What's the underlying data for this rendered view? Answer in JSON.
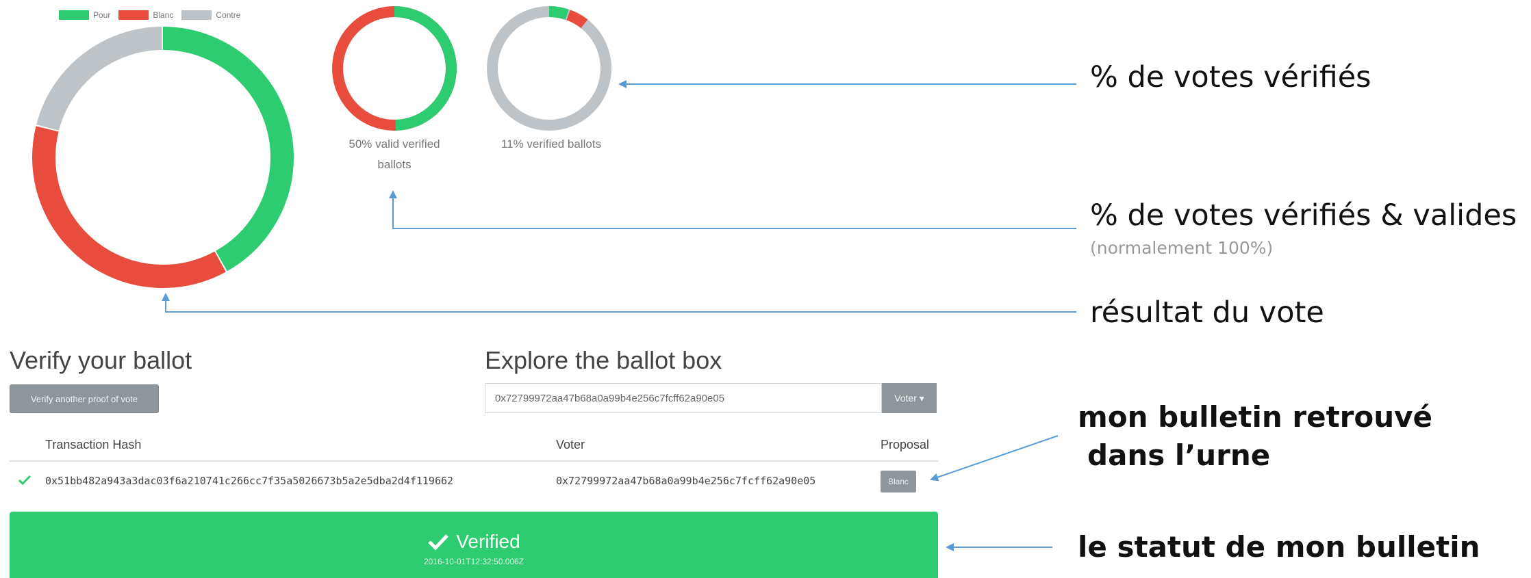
{
  "legend": [
    {
      "label": "Pour",
      "color": "#2ecc71"
    },
    {
      "label": "Blanc",
      "color": "#e74c3c"
    },
    {
      "label": "Contre",
      "color": "#bdc3c7"
    }
  ],
  "charts": {
    "result": {
      "pour": 0.42,
      "blanc": 0.37,
      "contre": 0.21
    },
    "valid": {
      "valid_fraction": 0.5,
      "caption": "50% valid verified ballots"
    },
    "verified": {
      "verified_fraction": 0.11,
      "caption": "11% verified ballots"
    }
  },
  "annotations": {
    "verified_pct": "% de votes vérifiés",
    "verified_valid_pct": "% de votes vérifiés & valides",
    "verified_valid_note": "(normalement 100%)",
    "vote_result": "résultat du vote",
    "ballot_found_line1": "mon bulletin retrouvé",
    "ballot_found_line2": "dans l’urne",
    "ballot_status": "le statut de mon bulletin"
  },
  "verify": {
    "title": "Verify your ballot",
    "button": "Verify another proof of vote"
  },
  "explore": {
    "title": "Explore the ballot box",
    "search_value": "0x72799972aa47b68a0a99b4e256c7fcff62a90e05",
    "dropdown_label": "Voter ▾"
  },
  "table": {
    "headers": {
      "hash": "Transaction Hash",
      "voter": "Voter",
      "proposal": "Proposal"
    },
    "row": {
      "hash": "0x51bb482a943a3dac03f6a210741c266cc7f35a5026673b5a2e5dba2d4f119662",
      "voter": "0x72799972aa47b68a0a99b4e256c7fcff62a90e05",
      "proposal": "Blanc"
    }
  },
  "status": {
    "label": "Verified",
    "timestamp": "2016-10-01T12:32:50.006Z"
  }
}
